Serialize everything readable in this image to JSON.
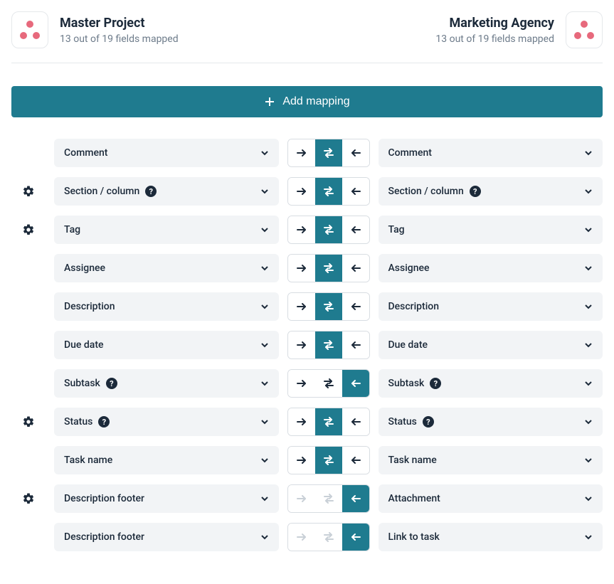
{
  "left_project": {
    "title": "Master Project",
    "sub": "13 out of 19 fields mapped"
  },
  "right_project": {
    "title": "Marketing Agency",
    "sub": "13 out of 19 fields mapped"
  },
  "add_button": "Add mapping",
  "rows": [
    {
      "gear": false,
      "left": "Comment",
      "leftHelp": false,
      "right": "Comment",
      "rightHelp": false,
      "dir": "bidi",
      "disabled": [
        false,
        false,
        false
      ]
    },
    {
      "gear": true,
      "left": "Section / column",
      "leftHelp": true,
      "right": "Section / column",
      "rightHelp": true,
      "dir": "bidi",
      "disabled": [
        false,
        false,
        false
      ]
    },
    {
      "gear": true,
      "left": "Tag",
      "leftHelp": false,
      "right": "Tag",
      "rightHelp": false,
      "dir": "bidi",
      "disabled": [
        false,
        false,
        false
      ]
    },
    {
      "gear": false,
      "left": "Assignee",
      "leftHelp": false,
      "right": "Assignee",
      "rightHelp": false,
      "dir": "bidi",
      "disabled": [
        false,
        false,
        false
      ]
    },
    {
      "gear": false,
      "left": "Description",
      "leftHelp": false,
      "right": "Description",
      "rightHelp": false,
      "dir": "bidi",
      "disabled": [
        false,
        false,
        false
      ]
    },
    {
      "gear": false,
      "left": "Due date",
      "leftHelp": false,
      "right": "Due date",
      "rightHelp": false,
      "dir": "bidi",
      "disabled": [
        false,
        false,
        false
      ]
    },
    {
      "gear": false,
      "left": "Subtask",
      "leftHelp": true,
      "right": "Subtask",
      "rightHelp": true,
      "dir": "left",
      "disabled": [
        false,
        false,
        false
      ]
    },
    {
      "gear": true,
      "left": "Status",
      "leftHelp": true,
      "right": "Status",
      "rightHelp": true,
      "dir": "bidi",
      "disabled": [
        false,
        false,
        false
      ]
    },
    {
      "gear": false,
      "left": "Task name",
      "leftHelp": false,
      "right": "Task name",
      "rightHelp": false,
      "dir": "bidi",
      "disabled": [
        false,
        false,
        false
      ]
    },
    {
      "gear": true,
      "left": "Description footer",
      "leftHelp": false,
      "right": "Attachment",
      "rightHelp": false,
      "dir": "left",
      "disabled": [
        true,
        true,
        false
      ]
    },
    {
      "gear": false,
      "left": "Description footer",
      "leftHelp": false,
      "right": "Link to task",
      "rightHelp": false,
      "dir": "left",
      "disabled": [
        true,
        true,
        false
      ]
    }
  ]
}
